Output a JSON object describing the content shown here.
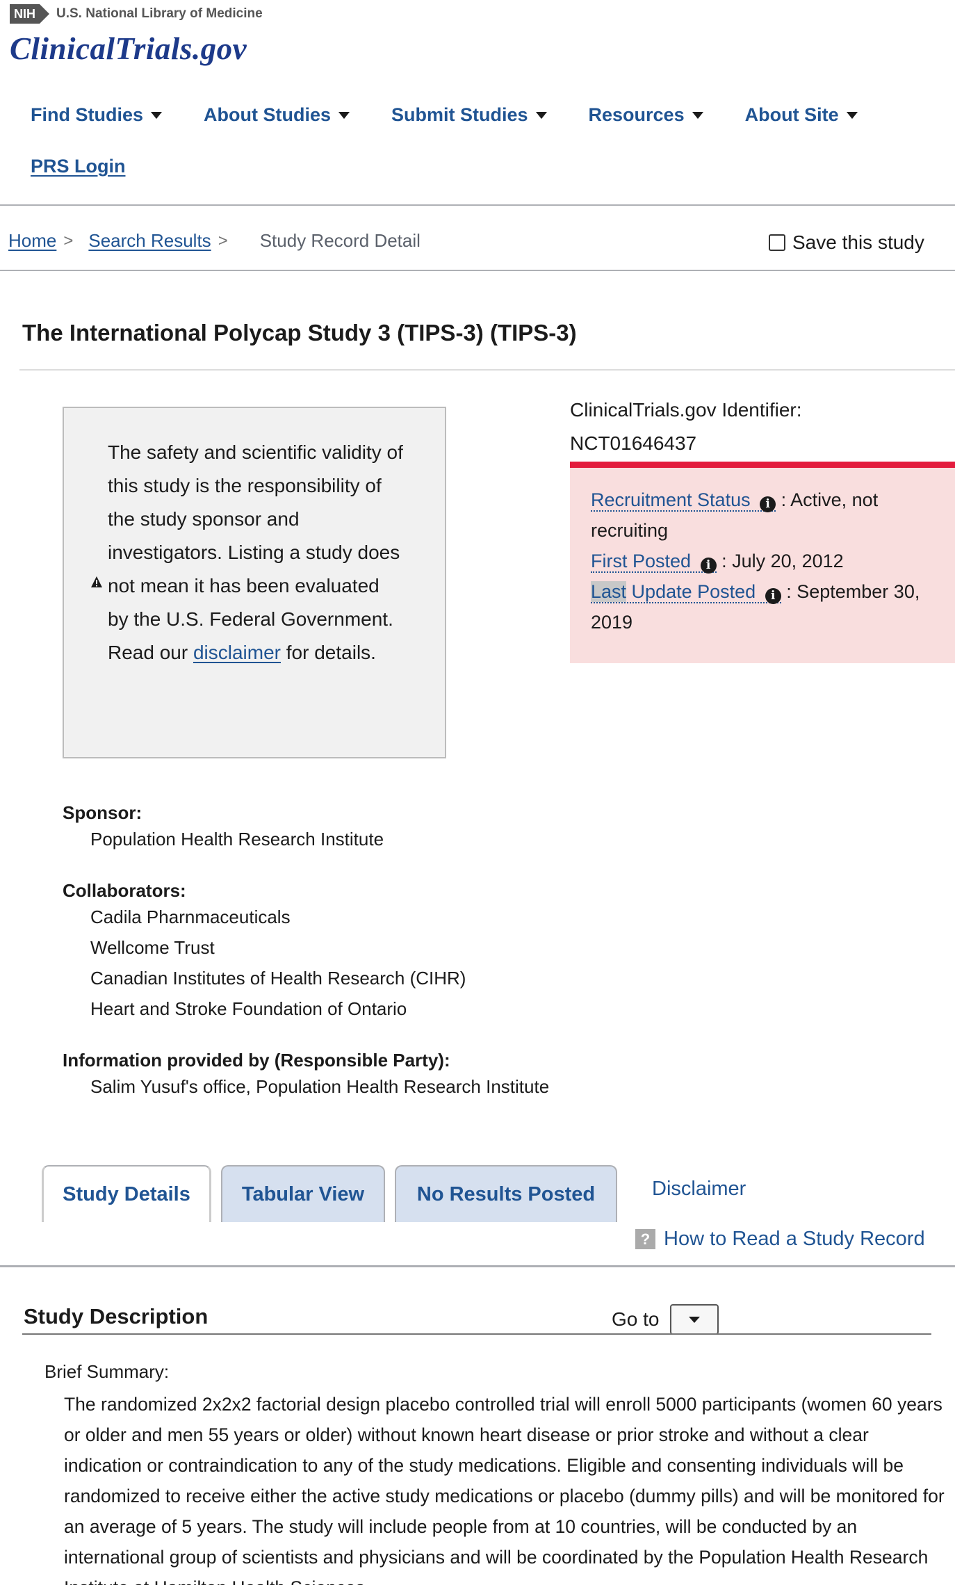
{
  "header": {
    "nih_badge": "NIH",
    "nlm_text": "U.S. National Library of Medicine",
    "logo_text": "ClinicalTrials.gov"
  },
  "nav": {
    "items": [
      {
        "label": "Find Studies"
      },
      {
        "label": "About Studies"
      },
      {
        "label": "Submit Studies"
      },
      {
        "label": "Resources"
      },
      {
        "label": "About Site"
      }
    ],
    "prs_login": "PRS Login"
  },
  "breadcrumb": {
    "home": "Home",
    "search_results": "Search Results",
    "current": "Study Record Detail",
    "separator": ">"
  },
  "save_study": "Save this study",
  "study": {
    "title": "The International Polycap Study 3 (TIPS-3) (TIPS-3)",
    "identifier_label": "ClinicalTrials.gov Identifier:",
    "identifier": "NCT01646437"
  },
  "disclaimer_box": {
    "line1": "The safety and scientific validity of this study is the responsibility of the study sponsor and investigators.",
    "line2": "Listing a study does not mean it has been evaluated by the U.S. Federal Government. Read our",
    "link": "disclaimer",
    "tail": "for details."
  },
  "status": {
    "recruitment_label": "Recruitment Status",
    "recruitment_value": ": Active, not recruiting",
    "first_posted_label": "First Posted",
    "first_posted_value": ": July 20, 2012",
    "last_update_label_a": "Last",
    "last_update_label_b": " Update Posted",
    "last_update_value": ": September 30, 2019",
    "colors": {
      "bg": "#f9dede",
      "border": "#e31c3d"
    }
  },
  "sponsor": {
    "label": "Sponsor:",
    "value": "Population Health Research Institute"
  },
  "collaborators": {
    "label": "Collaborators:",
    "items": [
      "Cadila Pharnmaceuticals",
      "Wellcome Trust",
      "Canadian Institutes of Health Research (CIHR)",
      "Heart and Stroke Foundation of Ontario"
    ]
  },
  "responsible_party": {
    "label": "Information provided by (Responsible Party):",
    "value": "Salim Yusuf's office, Population Health Research Institute"
  },
  "tabs": {
    "study_details": "Study Details",
    "tabular_view": "Tabular View",
    "no_results": "No Results Posted",
    "disclaimer": "Disclaimer",
    "how_to_read": "How to Read a Study Record",
    "help_glyph": "?"
  },
  "description": {
    "title": "Study Description",
    "goto_label": "Go to",
    "brief_label": "Brief Summary:",
    "brief_text": "The randomized 2x2x2 factorial design placebo controlled trial will enroll 5000 participants (women 60 years or older and men 55 years or older) without known heart disease or prior stroke and without a clear indication or contraindication to any of the study medications. Eligible and consenting individuals will be randomized to receive either the active study medications or placebo (dummy pills) and will be monitored for an average of 5 years. The study will include people from at 10 countries, will be conducted by an international group of scientists and physicians and will be coordinated by the Population Health Research Institute at Hamilton Health Sciences."
  }
}
